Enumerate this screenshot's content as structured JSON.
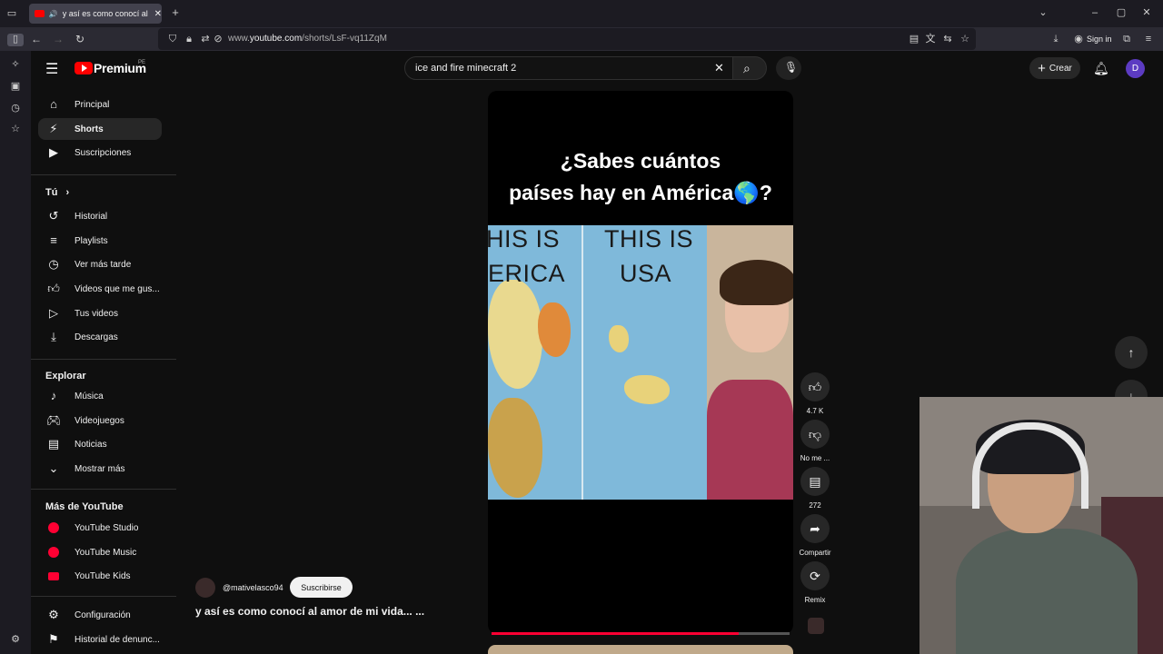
{
  "browser": {
    "tab_title": "y así es como conocí al amor de mi vida",
    "url_prefix": "www.",
    "url_host": "youtube.com",
    "url_path": "/shorts/LsF-vq11ZqM",
    "sign_in_label": "Sign in"
  },
  "header": {
    "logo_text": "Premium",
    "logo_region": "PE",
    "search_value": "ice and fire minecraft 2",
    "create_label": "Crear",
    "avatar_initial": "D"
  },
  "sidebar": {
    "main_items": [
      {
        "label": "Principal",
        "icon": "home-icon"
      },
      {
        "label": "Shorts",
        "icon": "shorts-icon"
      },
      {
        "label": "Suscripciones",
        "icon": "subscriptions-icon"
      }
    ],
    "you_header": "Tú",
    "you_items": [
      {
        "label": "Historial",
        "icon": "history-icon"
      },
      {
        "label": "Playlists",
        "icon": "playlist-icon"
      },
      {
        "label": "Ver más tarde",
        "icon": "watch-later-icon"
      },
      {
        "label": "Videos que me gus...",
        "icon": "like-icon"
      },
      {
        "label": "Tus videos",
        "icon": "video-icon"
      },
      {
        "label": "Descargas",
        "icon": "download-icon"
      }
    ],
    "explore_header": "Explorar",
    "explore_items": [
      {
        "label": "Música",
        "icon": "music-icon"
      },
      {
        "label": "Videojuegos",
        "icon": "gaming-icon"
      },
      {
        "label": "Noticias",
        "icon": "news-icon"
      },
      {
        "label": "Mostrar más",
        "icon": "chevron-down-icon"
      }
    ],
    "more_header": "Más de YouTube",
    "more_items": [
      {
        "label": "YouTube Studio"
      },
      {
        "label": "YouTube Music"
      },
      {
        "label": "YouTube Kids"
      }
    ],
    "bottom_items": [
      {
        "label": "Configuración",
        "icon": "gear-icon"
      },
      {
        "label": "Historial de denunc...",
        "icon": "flag-icon"
      }
    ]
  },
  "short": {
    "caption_line1": "¿Sabes cuántos",
    "caption_line2": "países hay en América🌎?",
    "map_left_text1": "HIS IS",
    "map_left_text2": "ERICA",
    "map_right_text1": "THIS IS",
    "map_right_text2": "USA",
    "progress": 0.83,
    "channel": "@mativelasco94",
    "subscribe_label": "Suscribirse",
    "title": "y así es como conocí al amor de mi vida... ..."
  },
  "actions": {
    "likes": "4.7 K",
    "dislike_label": "No me ...",
    "comments": "272",
    "share_label": "Compartir",
    "remix_label": "Remix"
  }
}
